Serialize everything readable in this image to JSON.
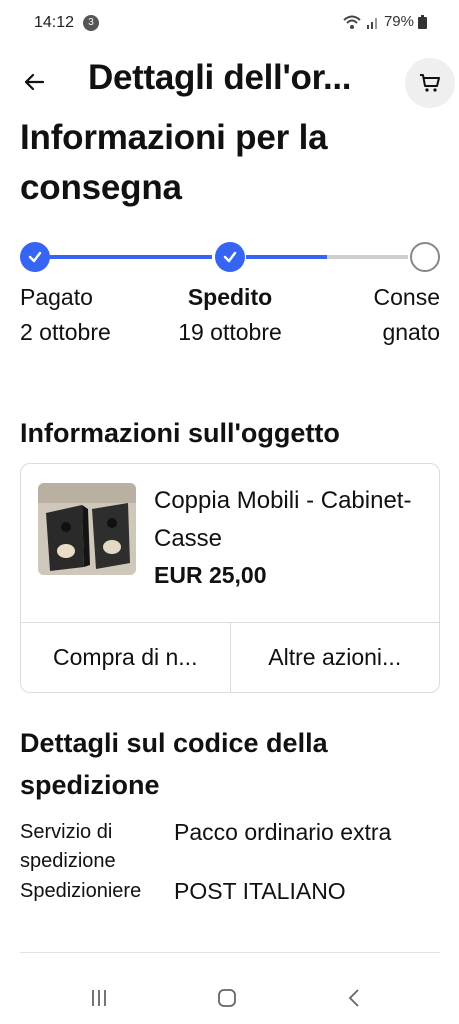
{
  "status_bar": {
    "time": "14:12",
    "notification_count": "3",
    "battery": "79%"
  },
  "header": {
    "title": "Dettagli dell'or..."
  },
  "delivery": {
    "title": "Informazioni per la consegna",
    "steps": [
      {
        "label": "Pagato",
        "date": "2 ottobre",
        "status": "done"
      },
      {
        "label": "Spedito",
        "date": "19 ottobre",
        "status": "done"
      },
      {
        "label": "Conse gnato",
        "date": "",
        "status": "pending"
      }
    ],
    "progress_fraction_second_segment": 0.5,
    "accent_color": "#3665f3"
  },
  "item_info": {
    "title": "Informazioni sull'oggetto",
    "item": {
      "name": "Coppia Mobili - Cabinet- Casse",
      "price": "EUR 25,00",
      "image": "speaker-cabinets-photo"
    },
    "actions": [
      "Compra di n...",
      "Altre azioni..."
    ]
  },
  "shipping": {
    "title": "Dettagli sul codice della spedizione",
    "rows": [
      {
        "key": "Servizio di spedizione",
        "value": "Pacco ordinario extra"
      },
      {
        "key": "Spedizioniere",
        "value": "POST ITALIANO"
      }
    ]
  },
  "icons": [
    "back-arrow-icon",
    "cart-icon",
    "check-icon",
    "recents-icon",
    "home-icon",
    "system-back-icon",
    "wifi-icon",
    "signal-icon",
    "battery-icon"
  ]
}
